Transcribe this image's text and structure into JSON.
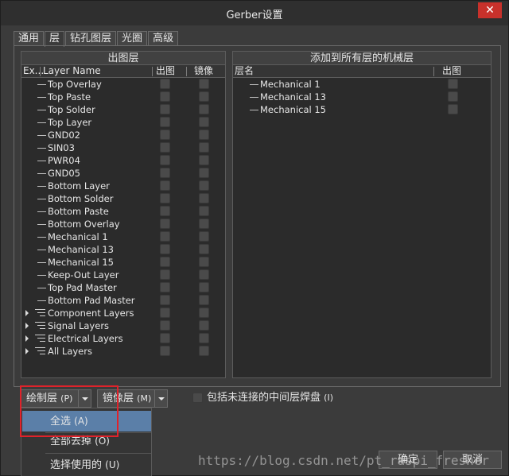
{
  "window": {
    "title": "Gerber设置",
    "close": "✕"
  },
  "tabs": [
    "通用",
    "层",
    "钻孔图层",
    "光圈",
    "高级"
  ],
  "left_panel": {
    "title": "出图层",
    "columns": {
      "expand": "Ex...",
      "name": "Layer Name",
      "plot": "出图",
      "mirror": "镜像"
    },
    "rows": [
      {
        "label": "Top Overlay",
        "group": false
      },
      {
        "label": "Top Paste",
        "group": false
      },
      {
        "label": "Top Solder",
        "group": false
      },
      {
        "label": "Top Layer",
        "group": false
      },
      {
        "label": "GND02",
        "group": false
      },
      {
        "label": "SIN03",
        "group": false
      },
      {
        "label": "PWR04",
        "group": false
      },
      {
        "label": "GND05",
        "group": false
      },
      {
        "label": "Bottom Layer",
        "group": false
      },
      {
        "label": "Bottom Solder",
        "group": false
      },
      {
        "label": "Bottom Paste",
        "group": false
      },
      {
        "label": "Bottom Overlay",
        "group": false
      },
      {
        "label": "Mechanical 1",
        "group": false
      },
      {
        "label": "Mechanical 13",
        "group": false
      },
      {
        "label": "Mechanical 15",
        "group": false
      },
      {
        "label": "Keep-Out Layer",
        "group": false
      },
      {
        "label": "Top Pad Master",
        "group": false
      },
      {
        "label": "Bottom Pad Master",
        "group": false
      },
      {
        "label": "Component Layers",
        "group": true
      },
      {
        "label": "Signal Layers",
        "group": true
      },
      {
        "label": "Electrical Layers",
        "group": true
      },
      {
        "label": "All Layers",
        "group": true
      }
    ]
  },
  "right_panel": {
    "title": "添加到所有层的机械层",
    "columns": {
      "name": "层名",
      "plot": "出图"
    },
    "rows": [
      {
        "label": "Mechanical 1"
      },
      {
        "label": "Mechanical 13"
      },
      {
        "label": "Mechanical 15"
      }
    ]
  },
  "controls": {
    "plot_layers": {
      "label": "绘制层",
      "shortcut": "(P)"
    },
    "mirror_layers": {
      "label": "镜像层",
      "shortcut": "(M)"
    },
    "include_pads": {
      "label": "包括未连接的中间层焊盘",
      "shortcut": "(I)"
    }
  },
  "menu": {
    "items": [
      {
        "label": "全选",
        "shortcut": "(A)"
      },
      {
        "label": "全部去掉",
        "shortcut": "(O)"
      },
      {
        "label": "选择使用的",
        "shortcut": "(U)"
      }
    ]
  },
  "buttons": {
    "ok": "确定",
    "cancel": "取消"
  },
  "watermark": "https://blog.csdn.net/pt_raspi_fresher",
  "colors": {
    "highlight": "#5b7fa8",
    "callout": "#e0222a",
    "close": "#c8312b"
  }
}
